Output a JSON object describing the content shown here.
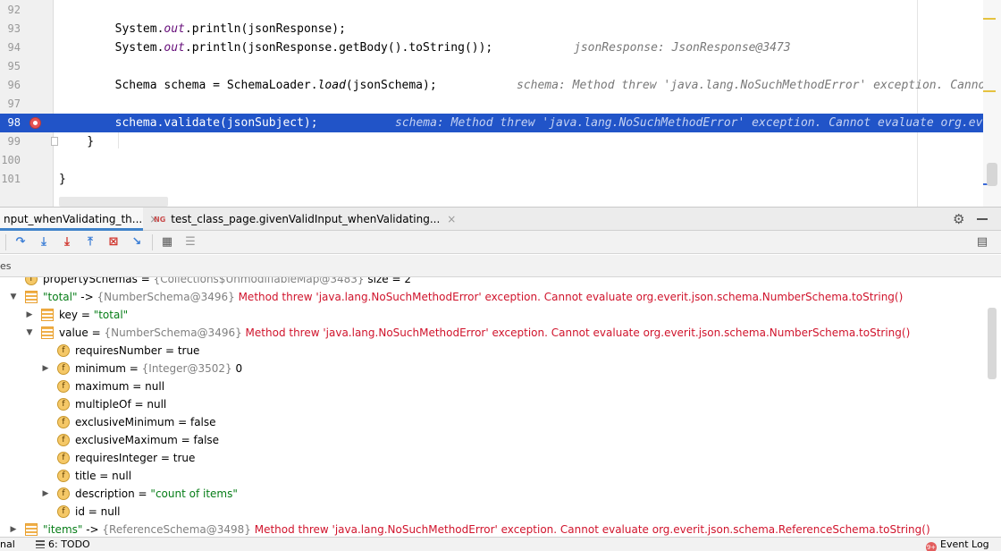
{
  "editor": {
    "lines": [
      {
        "number": "92",
        "code": ""
      },
      {
        "number": "93",
        "pre": "        System.",
        "static": "out",
        "post": ".println(jsonResponse);"
      },
      {
        "number": "94",
        "pre": "        System.",
        "static": "out",
        "post": ".println(jsonResponse.getBody().toString());",
        "hint": "jsonResponse: JsonResponse@3473"
      },
      {
        "number": "95",
        "code": ""
      },
      {
        "number": "96",
        "pre": "        Schema schema = SchemaLoader.",
        "italic": "load",
        "post": "(jsonSchema);",
        "hint": "schema: Method threw 'java.lang.NoSuchMethodError' exception. Cannot"
      },
      {
        "number": "97",
        "code": ""
      },
      {
        "number": "98",
        "code": "        schema.validate(jsonSubject);",
        "hint": "schema: Method threw 'java.lang.NoSuchMethodError' exception. Cannot evaluate org.everit"
      },
      {
        "number": "99",
        "code": "    }"
      },
      {
        "number": "100",
        "code": ""
      },
      {
        "number": "101",
        "code": "}"
      }
    ]
  },
  "debug": {
    "tabs": [
      {
        "label": "nput_whenValidating_th...",
        "active": true
      },
      {
        "label": "test_class_page.givenValidInput_whenValidating...",
        "active": false,
        "icon": "NG"
      }
    ],
    "close_glyph": "×",
    "gear_glyph": "⚙",
    "variables_label": "es"
  },
  "toolbar": {
    "icons": [
      "step-over-icon",
      "step-into-icon",
      "force-step-into-icon",
      "step-out-icon",
      "drop-frame-icon",
      "run-to-cursor-icon",
      "evaluate-expression-icon",
      "trace-icon",
      "restore-layout-icon"
    ]
  },
  "tree": [
    {
      "level": 0,
      "icon": "f",
      "arrow": "",
      "name": "propertySchemas",
      "sep": " = ",
      "meta": "{Collections$UnmodifiableMap@3483}",
      "tail": "  size = 2",
      "partial": true
    },
    {
      "level": 0,
      "icon": "list",
      "arrow": "▼",
      "name": "\"total\"",
      "name_is_str": true,
      "sep": " -> ",
      "meta": "{NumberSchema@3496}",
      "err": " Method threw 'java.lang.NoSuchMethodError' exception. Cannot evaluate org.everit.json.schema.NumberSchema.toString()"
    },
    {
      "level": 1,
      "icon": "list",
      "arrow": "▶",
      "name": "key",
      "sep": " = ",
      "str": "\"total\""
    },
    {
      "level": 1,
      "icon": "list",
      "arrow": "▼",
      "name": "value",
      "sep": " = ",
      "meta": "{NumberSchema@3496}",
      "err": " Method threw 'java.lang.NoSuchMethodError' exception. Cannot evaluate org.everit.json.schema.NumberSchema.toString()"
    },
    {
      "level": 2,
      "icon": "f",
      "arrow": "",
      "name": "requiresNumber",
      "sep": " = ",
      "val": "true"
    },
    {
      "level": 2,
      "icon": "f",
      "arrow": "▶",
      "name": "minimum",
      "sep": " = ",
      "meta": "{Integer@3502}",
      "val": " 0"
    },
    {
      "level": 2,
      "icon": "f",
      "arrow": "",
      "name": "maximum",
      "sep": " = ",
      "val": "null"
    },
    {
      "level": 2,
      "icon": "f",
      "arrow": "",
      "name": "multipleOf",
      "sep": " = ",
      "val": "null"
    },
    {
      "level": 2,
      "icon": "f",
      "arrow": "",
      "name": "exclusiveMinimum",
      "sep": " = ",
      "val": "false"
    },
    {
      "level": 2,
      "icon": "f",
      "arrow": "",
      "name": "exclusiveMaximum",
      "sep": " = ",
      "val": "false"
    },
    {
      "level": 2,
      "icon": "f",
      "arrow": "",
      "name": "requiresInteger",
      "sep": " = ",
      "val": "true"
    },
    {
      "level": 2,
      "icon": "f",
      "arrow": "",
      "name": "title",
      "sep": " = ",
      "val": "null"
    },
    {
      "level": 2,
      "icon": "f",
      "arrow": "▶",
      "name": "description",
      "sep": " = ",
      "str": "\"count of items\""
    },
    {
      "level": 2,
      "icon": "f",
      "arrow": "",
      "name": "id",
      "sep": " = ",
      "val": "null"
    },
    {
      "level": 0,
      "icon": "list",
      "arrow": "▶",
      "name": "\"items\"",
      "name_is_str": true,
      "sep": " -> ",
      "meta": "{ReferenceSchema@3498}",
      "err": " Method threw 'java.lang.NoSuchMethodError' exception. Cannot evaluate org.everit.json.schema.ReferenceSchema.toString()",
      "partial": true
    }
  ],
  "status": {
    "terminal": "nal",
    "todo": "6: TODO",
    "event_log": "Event Log",
    "event_badge": "9+"
  },
  "colors": {
    "accent": "#2154c8",
    "error": "#d0142c",
    "string": "#067d17"
  }
}
